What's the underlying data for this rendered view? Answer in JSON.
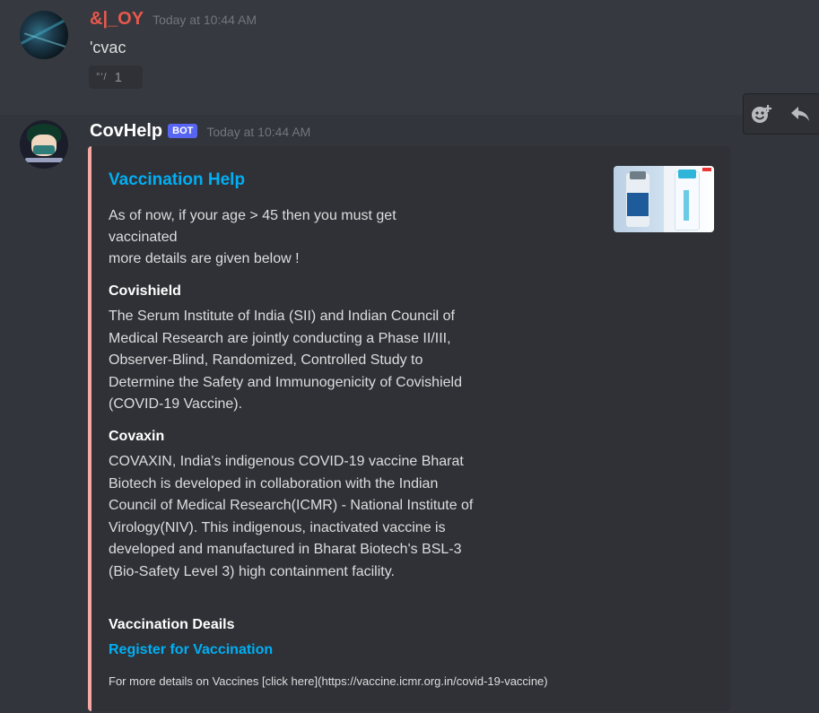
{
  "message1": {
    "username": "&|_OY",
    "timestamp": "Today at 10:44 AM",
    "content": "'cvac",
    "reaction": {
      "emoji_glyph": "°'/",
      "count": "1"
    }
  },
  "message2": {
    "username": "CovHelp",
    "bot_tag": "BOT",
    "timestamp": "Today at 10:44 AM",
    "embed": {
      "accent_color": "#f7a7a4",
      "title": "Vaccination Help",
      "description_line1": "As of now, if your age > 45 then you must get vaccinated",
      "description_line2": "more details are given below !",
      "fields": [
        {
          "name": "Covishield",
          "value": "The Serum Institute of India (SII) and Indian Council of Medical Research are jointly conducting a Phase II/III, Observer-Blind, Randomized, Controlled Study to Determine the Safety and Immunogenicity of Covishield (COVID-19 Vaccine)."
        },
        {
          "name": "Covaxin",
          "value": "COVAXIN, India's indigenous COVID-19 vaccine Bharat Biotech is developed in collaboration with the Indian Council of Medical Research(ICMR) - National Institute of Virology(NIV). This indigenous, inactivated vaccine is developed and manufactured in Bharat Biotech's BSL-3 (Bio-Safety Level 3) high containment facility."
        },
        {
          "name": "Vaccination Deails",
          "link": "Register for Vaccination"
        }
      ],
      "footer": "For more details on Vaccines [click here](https://vaccine.icmr.org.in/covid-19-vaccine)"
    }
  },
  "toolbar": {
    "icons": [
      "add-reaction-icon",
      "reply-icon"
    ]
  },
  "colors": {
    "background": "#36393f",
    "hover_background": "#32353b",
    "embed_background": "#2f3136",
    "link": "#00aff4",
    "username1": "#e8584d",
    "bot_tag": "#5865f2"
  }
}
